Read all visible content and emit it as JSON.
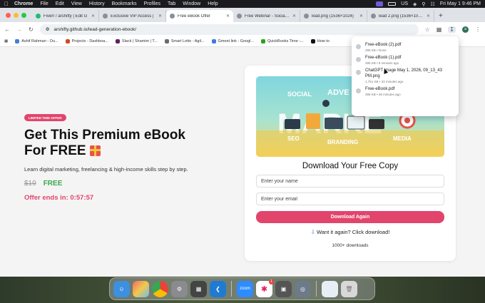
{
  "menubar": {
    "app": "Chrome",
    "items": [
      "File",
      "Edit",
      "View",
      "History",
      "Bookmarks",
      "Profiles",
      "Tab",
      "Window",
      "Help"
    ],
    "input_indicator": "US",
    "datetime": "Fri May 1  9:46 PM"
  },
  "tabs": [
    {
      "title": "Fiverr / arshifty | Edit G",
      "color": "#1dbf73",
      "active": false
    },
    {
      "title": "Exclusive VIP Access |",
      "color": "#6b6b6b",
      "active": false
    },
    {
      "title": "Free eBook Offer",
      "color": "#6b6b6b",
      "active": true
    },
    {
      "title": "Free Webinar - Social S",
      "color": "#6b6b6b",
      "active": false
    },
    {
      "title": "lead.png (1536×1024)",
      "color": "#6b6b6b",
      "active": false
    },
    {
      "title": "lead 2.png (1536×1024)",
      "color": "#6b6b6b",
      "active": false
    }
  ],
  "address": {
    "url": "arshifty.github.io/lead-generation-ebook/",
    "avatar": "a"
  },
  "bookmarks": [
    {
      "label": "Ashif Rahman - Ou...",
      "color": "#4a7bd8"
    },
    {
      "label": "Projects - Dashboa...",
      "color": "#d04a2a"
    },
    {
      "label": "Slack | Shamim | T...",
      "color": "#611f69"
    },
    {
      "label": "Smart Lotto - Agil...",
      "color": "#6b6b6b"
    },
    {
      "label": "Gmeet link - Googl...",
      "color": "#3d7be0"
    },
    {
      "label": "QuickBooks Time -...",
      "color": "#2ca01c"
    },
    {
      "label": "How to",
      "color": "#111111"
    }
  ],
  "hero": {
    "badge": "LIMITED TIME OFFER",
    "title_line1": "Get This Premium eBook",
    "title_line2": "For FREE",
    "subtitle": "Learn digital marketing, freelancing & high-income skills step by step.",
    "old_price": "$19",
    "new_price": "FREE",
    "timer": "Offer ends in: 0:57:57"
  },
  "form": {
    "heading": "Download Your Free Copy",
    "name_placeholder": "Enter your name",
    "email_placeholder": "Enter your email",
    "button": "Download Again",
    "again_text": "Want it again? Click download!",
    "downloads": "1000+ downloads"
  },
  "banner_words": {
    "social": "SOCIAL",
    "adve": "ADVE",
    "market": "MARKE",
    "seo": "SEO",
    "branding": "BRANDING",
    "media": "MEDIA"
  },
  "downloads_popup": [
    {
      "name": "Free-eBook (2).pdf",
      "meta": "395 KB • Done"
    },
    {
      "name": "Free-eBook (1).pdf",
      "meta": "395 KB • 8 minutes ago"
    },
    {
      "name": "ChatGPT Image May 1, 2026, 09_13_43 PM.png",
      "meta": "1,751 KB • 33 minutes ago"
    },
    {
      "name": "Free-eBook.pdf",
      "meta": "395 KB • 46 minutes ago"
    }
  ],
  "dock": {
    "apps": [
      {
        "name": "finder",
        "color": "#3d8fe0"
      },
      {
        "name": "launchpad",
        "color": "#e0a030"
      },
      {
        "name": "chrome",
        "color": "#ffffff"
      },
      {
        "name": "system-settings",
        "color": "#8a8a8f"
      },
      {
        "name": "calculator",
        "color": "#444444"
      },
      {
        "name": "vscode",
        "color": "#1f7bd2"
      },
      {
        "name": "zoom",
        "color": "#2d8cff",
        "label": "zoom"
      },
      {
        "name": "slack",
        "color": "#ffffff",
        "badge": "1"
      },
      {
        "name": "screenshot",
        "color": "#555555"
      },
      {
        "name": "preview",
        "color": "#6c7a89"
      },
      {
        "name": "downloads-stack",
        "color": "#e8eef6"
      },
      {
        "name": "trash",
        "color": "#d8d8d8"
      }
    ]
  }
}
